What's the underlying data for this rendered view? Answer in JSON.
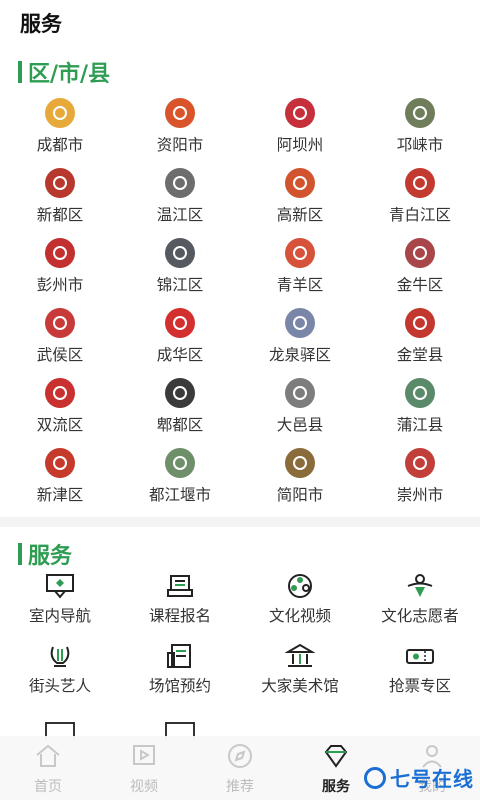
{
  "page_title": "服务",
  "districts_section": {
    "title": "区/市/县"
  },
  "districts": [
    {
      "label": "成都市",
      "color": "#e8a93b",
      "icon": "chengdu-logo-icon"
    },
    {
      "label": "资阳市",
      "color": "#d9532b",
      "icon": "ziyang-logo-icon"
    },
    {
      "label": "阿坝州",
      "color": "#c6303a",
      "icon": "aba-logo-icon"
    },
    {
      "label": "邛崃市",
      "color": "#6f7d5a",
      "icon": "qionglai-logo-icon"
    },
    {
      "label": "新都区",
      "color": "#b9382e",
      "icon": "xindu-logo-icon"
    },
    {
      "label": "温江区",
      "color": "#6d6d6d",
      "icon": "wenjiang-logo-icon"
    },
    {
      "label": "高新区",
      "color": "#d2542f",
      "icon": "gaoxin-logo-icon"
    },
    {
      "label": "青白江区",
      "color": "#c33a30",
      "icon": "qingbaijiang-logo-icon"
    },
    {
      "label": "彭州市",
      "color": "#c23030",
      "icon": "pengzhou-logo-icon"
    },
    {
      "label": "锦江区",
      "color": "#555a60",
      "icon": "jinjiang-logo-icon"
    },
    {
      "label": "青羊区",
      "color": "#d6523a",
      "icon": "qingyang-logo-icon"
    },
    {
      "label": "金牛区",
      "color": "#a8464a",
      "icon": "jinniu-logo-icon"
    },
    {
      "label": "武侯区",
      "color": "#c83a3a",
      "icon": "wuhou-logo-icon"
    },
    {
      "label": "成华区",
      "color": "#d32f2f",
      "icon": "chenghua-logo-icon"
    },
    {
      "label": "龙泉驿区",
      "color": "#7a86a8",
      "icon": "longquanyi-logo-icon"
    },
    {
      "label": "金堂县",
      "color": "#c2382e",
      "icon": "jintang-logo-icon"
    },
    {
      "label": "双流区",
      "color": "#c8312f",
      "icon": "shuangliu-logo-icon"
    },
    {
      "label": "郫都区",
      "color": "#3b3b3b",
      "icon": "pidu-logo-icon"
    },
    {
      "label": "大邑县",
      "color": "#7d7d7d",
      "icon": "dayi-logo-icon"
    },
    {
      "label": "蒲江县",
      "color": "#5b8a6a",
      "icon": "pujiang-logo-icon"
    },
    {
      "label": "新津区",
      "color": "#c63a2c",
      "icon": "xinjin-logo-icon"
    },
    {
      "label": "都江堰市",
      "color": "#6f8f6a",
      "icon": "dujiangyan-logo-icon"
    },
    {
      "label": "简阳市",
      "color": "#8a6b3a",
      "icon": "jianyang-logo-icon"
    },
    {
      "label": "崇州市",
      "color": "#c23e3a",
      "icon": "chongzhou-logo-icon"
    }
  ],
  "services_section": {
    "title": "服务"
  },
  "services": [
    {
      "label": "室内导航",
      "icon": "indoor-map-icon"
    },
    {
      "label": "课程报名",
      "icon": "course-signup-icon"
    },
    {
      "label": "文化视频",
      "icon": "film-reel-icon"
    },
    {
      "label": "文化志愿者",
      "icon": "volunteer-icon"
    },
    {
      "label": "街头艺人",
      "icon": "lyre-icon"
    },
    {
      "label": "场馆预约",
      "icon": "venue-booking-icon"
    },
    {
      "label": "大家美术馆",
      "icon": "museum-icon"
    },
    {
      "label": "抢票专区",
      "icon": "ticket-icon"
    }
  ],
  "tabs": [
    {
      "label": "首页",
      "icon": "home-icon",
      "active": false
    },
    {
      "label": "视频",
      "icon": "video-icon",
      "active": false
    },
    {
      "label": "推荐",
      "icon": "compass-icon",
      "active": false
    },
    {
      "label": "服务",
      "icon": "diamond-icon",
      "active": true
    },
    {
      "label": "我的",
      "icon": "person-icon",
      "active": false
    }
  ],
  "watermark": {
    "text": "七号在线"
  },
  "colors": {
    "accent": "#2e9c52",
    "text": "#333333",
    "watermark": "#1b6fd4"
  }
}
